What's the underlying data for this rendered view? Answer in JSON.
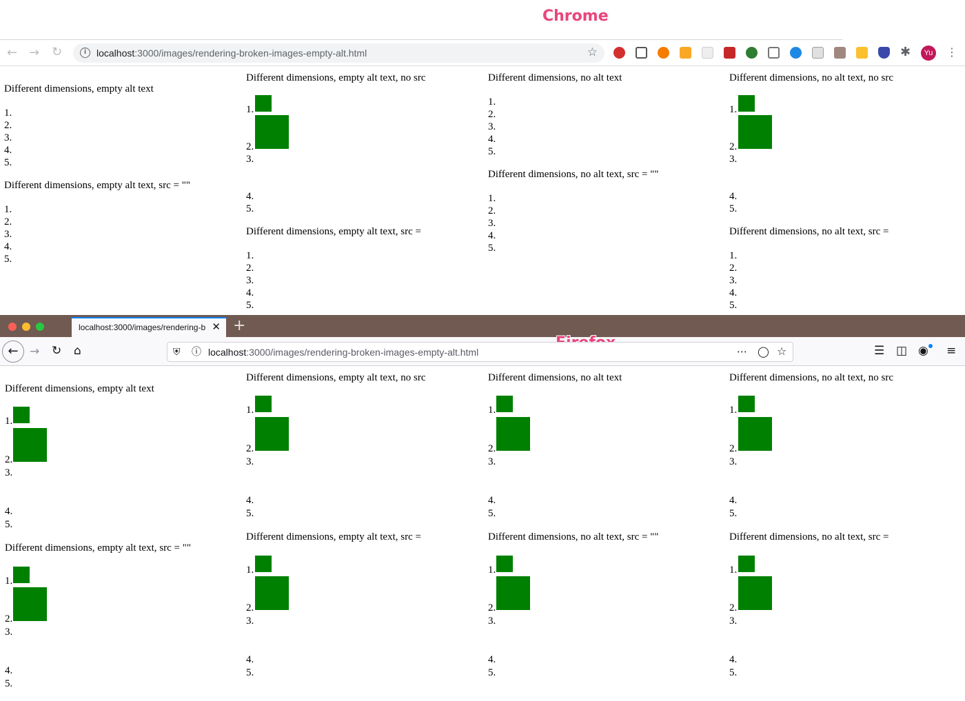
{
  "labels": {
    "chrome": "Chrome",
    "firefox": "Firefox"
  },
  "chrome": {
    "url_host": "localhost",
    "url_path": ":3000/images/rendering-broken-images-empty-alt.html",
    "avatar": "Yu",
    "icons": [
      "back-arrow-icon",
      "forward-arrow-icon",
      "reload-icon",
      "info-icon",
      "star-icon",
      "extensions-icon",
      "kebab-menu-icon"
    ]
  },
  "firefox": {
    "tab_title": "localhost:3000/images/rendering-b",
    "url_host": "localhost",
    "url_path": ":3000/images/rendering-broken-images-empty-alt.html",
    "icons": [
      "back-arrow-icon",
      "forward-arrow-icon",
      "reload-icon",
      "home-icon",
      "shield-icon",
      "info-icon",
      "page-actions-icon",
      "pocket-icon",
      "star-icon",
      "library-icon",
      "sidebar-icon",
      "account-icon",
      "hamburger-menu-icon"
    ]
  },
  "headings": {
    "empty_alt": "Different dimensions, empty alt text",
    "empty_alt_src_quotes": "Different dimensions, empty alt text, src = \"\"",
    "empty_alt_no_src": "Different dimensions, empty alt text, no src",
    "empty_alt_src_eq": "Different dimensions, empty alt text, src =",
    "no_alt": "Different dimensions, no alt text",
    "no_alt_src_quotes": "Different dimensions, no alt text, src = \"\"",
    "no_alt_no_src": "Different dimensions, no alt text, no src",
    "no_alt_src_eq": "Different dimensions, no alt text, src ="
  },
  "list_markers": [
    "1.",
    "2.",
    "3.",
    "4.",
    "5."
  ],
  "colors": {
    "image_fill": "#008000",
    "label_pink": "#e8457e",
    "firefox_titlebar": "#705a52"
  }
}
